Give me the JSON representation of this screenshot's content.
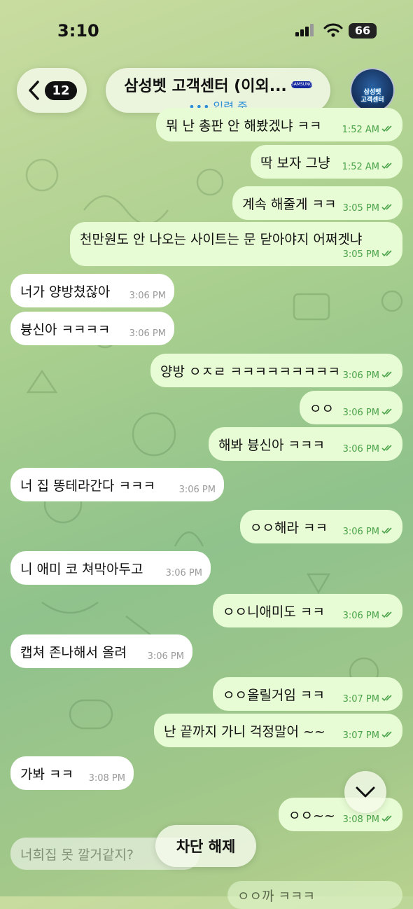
{
  "status_bar": {
    "time": "3:10",
    "battery": "66"
  },
  "header": {
    "back_count": "12",
    "title": "삼성벳 고객센터 (이외...",
    "title_logo_text": "SAMSUNG",
    "status": "입력 중",
    "avatar_text_1": "삼성벳",
    "avatar_text_2": "고객센터"
  },
  "colors": {
    "outgoing": "#e7fcd4",
    "incoming": "#ffffff",
    "check": "#4aa24a",
    "typing": "#2a8fd8"
  },
  "messages": [
    {
      "dir": "out",
      "text": "뭐 난 총판 안 해봤겠냐 ㅋㅋ",
      "time": "1:52 AM",
      "read": true
    },
    {
      "dir": "out",
      "text": "딱 보자 그냥",
      "time": "1:52 AM",
      "read": true
    },
    {
      "dir": "out",
      "text": "계속 해줄게 ㅋㅋ",
      "time": "3:05 PM",
      "read": true
    },
    {
      "dir": "out",
      "text": "천만원도 안 나오는 사이트는 문 닫아야지 어쩌겟냐",
      "time": "3:05 PM",
      "read": true
    },
    {
      "dir": "in",
      "text": "너가 양방쳤잖아",
      "time": "3:06 PM"
    },
    {
      "dir": "in",
      "text": "븅신아 ㅋㅋㅋㅋ",
      "time": "3:06 PM"
    },
    {
      "dir": "out",
      "text": "양방 ㅇㅈㄹ ㅋㅋㅋㅋㅋㅋㅋㅋㅋ",
      "time": "3:06 PM",
      "read": true
    },
    {
      "dir": "out",
      "text": "ㅇㅇ",
      "time": "3:06 PM",
      "read": true
    },
    {
      "dir": "out",
      "text": "해봐 븅신아 ㅋㅋㅋ",
      "time": "3:06 PM",
      "read": true
    },
    {
      "dir": "in",
      "text": "너 집 똥테라간다 ㅋㅋㅋ",
      "time": "3:06 PM"
    },
    {
      "dir": "out",
      "text": "ㅇㅇ해라 ㅋㅋ",
      "time": "3:06 PM",
      "read": true
    },
    {
      "dir": "in",
      "text": "니 애미 코 쳐막아두고",
      "time": "3:06 PM"
    },
    {
      "dir": "out",
      "text": "ㅇㅇ니애미도 ㅋㅋ",
      "time": "3:06 PM",
      "read": true
    },
    {
      "dir": "in",
      "text": "캡쳐 존나해서 올려",
      "time": "3:06 PM"
    },
    {
      "dir": "out",
      "text": "ㅇㅇ올릴거임 ㅋㅋ",
      "time": "3:07 PM",
      "read": true
    },
    {
      "dir": "out",
      "text": "난 끝까지 가니 걱정말어 ~~",
      "time": "3:07 PM",
      "read": true
    },
    {
      "dir": "in",
      "text": "가봐 ㅋㅋ",
      "time": "3:08 PM"
    },
    {
      "dir": "out",
      "text": "ㅇㅇ~~",
      "time": "3:08 PM",
      "read": true
    }
  ],
  "partial_incoming_text": "너희집 못 깔거같지?",
  "partial_outgoing_text": "ㅇㅇ까 ㅋㅋㅋ",
  "unblock_label": "차단 해제"
}
